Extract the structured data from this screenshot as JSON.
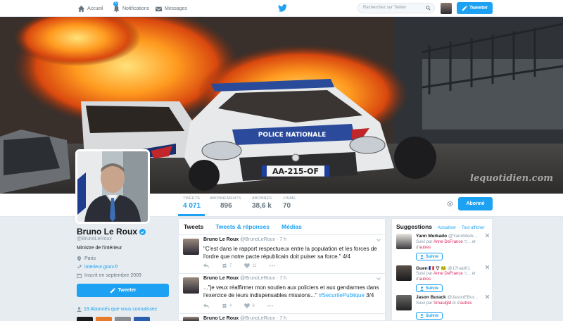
{
  "nav": {
    "home_label": "Accueil",
    "notifications_label": "Notifications",
    "notifications_badge": "5",
    "messages_label": "Messages",
    "search_placeholder": "Recherchez sur Twitter",
    "tweet_button": "Tweeter"
  },
  "banner": {
    "plate": "AA-215-OF",
    "car_text": "POLICE NATIONALE",
    "watermark": "lequotidien.com"
  },
  "stats": [
    {
      "label": "Tweets",
      "value": "4 071"
    },
    {
      "label": "Abonnements",
      "value": "896"
    },
    {
      "label": "Abonnés",
      "value": "38,6 k"
    },
    {
      "label": "J'aime",
      "value": "70"
    }
  ],
  "follow_button": "Abonné",
  "profile": {
    "name": "Bruno Le Roux",
    "handle": "@BrunoLeRoux",
    "bio": "Ministre de l'intérieur",
    "location": "Paris",
    "website": "interieur.gouv.fr",
    "joined": "Inscrit en septembre 2009",
    "tweet_button": "Tweeter",
    "followers_you_know": "19 Abonnés que vous connaissez"
  },
  "timeline": {
    "tabs": [
      "Tweets",
      "Tweets & réponses",
      "Médias"
    ],
    "tweets": [
      {
        "name": "Bruno Le Roux",
        "meta": "@BrunoLeRoux · 7 h",
        "text": "\"C'est dans le rapport respectueux entre la population et les forces de l'ordre que notre pacte républicain doit puiser sa force.\" 4/4",
        "retweets": "7",
        "likes": "11"
      },
      {
        "name": "Bruno Le Roux",
        "meta": "@BrunoLeRoux · 7 h",
        "text": "...\"je veux réaffirmer mon soutien aux policiers et aux gendarmes dans l'exercice de leurs indispensables missions...\" ",
        "hashtag": "#SecuritePublique",
        "suffix": " 3/4",
        "retweets": "4",
        "likes": "8"
      },
      {
        "name": "Bruno Le Roux",
        "meta": "@BrunoLeRoux · 7 h"
      }
    ]
  },
  "suggestions": {
    "title": "Suggestions",
    "refresh": "· Actualiser",
    "show_all": "· Tout afficher",
    "follow_label": "Suivre",
    "items": [
      {
        "name": "Yann Merkado",
        "handle": "@YannMerk...",
        "via_prefix": "Suivi par ",
        "via_user": "Anne DeFrance",
        "via_suffix": " ▽... et d'",
        "via_more": "autres"
      },
      {
        "name": "Guen 🇫🇷 ▽ 🐸",
        "handle": "@17nad01",
        "via_prefix": "Suivi par ",
        "via_user": "Anne DeFrance",
        "via_suffix": " ▽... et d'",
        "via_more": "autres"
      },
      {
        "name": "Jason Burack",
        "handle": "@JasonEBur...",
        "via_prefix": "Suivi par ",
        "via_user": "Smaulgld",
        "via_suffix": " et d'",
        "via_more": "autres"
      }
    ]
  },
  "colors": {
    "accent": "#1da1f2",
    "background": "#e6ecf0",
    "link_red": "#e0245e"
  }
}
